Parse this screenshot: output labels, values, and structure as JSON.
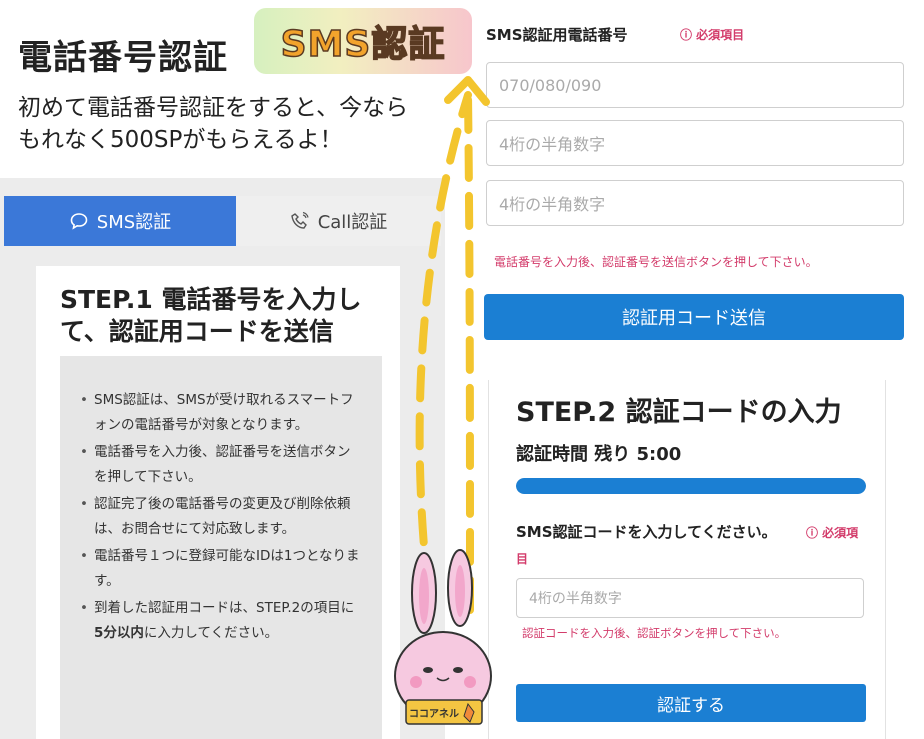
{
  "header": {
    "title": "電話番号認証",
    "line1": "初めて電話番号認証をすると、今なら",
    "line2": "もれなく500SPがもらえるよ！"
  },
  "sticker": {
    "text": "SMS認証"
  },
  "tabs": [
    {
      "label": "SMS認証",
      "icon": "chat-bubble-icon",
      "active": true
    },
    {
      "label": "Call認証",
      "icon": "phone-icon",
      "active": false
    }
  ],
  "step1": {
    "title": "STEP.1 電話番号を入力して、認証用コードを送信",
    "items": [
      "SMS認証は、SMSが受け取れるスマートフォンの電話番号が対象となります。",
      "電話番号を入力後、認証番号を送信ボタンを押して下さい。",
      "認証完了後の電話番号の変更及び削除依頼は、お問合せにて対応致します。",
      "電話番号１つに登録可能なIDは1つとなります。"
    ],
    "last_item": {
      "pre": "到着した認証用コードは、STEP.2の項目に",
      "bold": "5分以内",
      "post": "に入力してください。"
    }
  },
  "form": {
    "phone_label": "SMS認証用電話番号",
    "required": "ⓘ 必須項目",
    "phone_placeholder": "070/080/090",
    "p2_placeholder": "4桁の半角数字",
    "p3_placeholder": "4桁の半角数字",
    "note": "電話番号を入力後、認証番号を送信ボタンを押して下さい。",
    "send_button": "認証用コード送信"
  },
  "step2": {
    "title": "STEP.2 認証コードの入力",
    "timer": "認証時間 残り 5:00",
    "progress": 1.0,
    "code_label": "SMS認証コードを入力してください。",
    "required_a": "ⓘ 必須項",
    "required_b": "目",
    "code_placeholder": "4桁の半角数字",
    "note": "認証コードを入力後、認証ボタンを押して下さい。",
    "verify_button": "認証する"
  },
  "mascot": {
    "sign": "ココアネル"
  },
  "colors": {
    "accent": "#1b7fd3",
    "tab_active": "#3b78d8",
    "required": "#d33c6b",
    "arrow": "#f3c52e"
  }
}
